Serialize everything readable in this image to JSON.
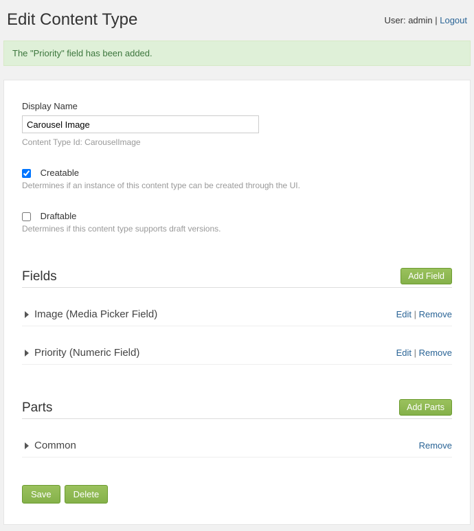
{
  "header": {
    "title": "Edit Content Type",
    "user_prefix": "User: ",
    "user_name": "admin",
    "sep": " | ",
    "logout": "Logout"
  },
  "notice": "The \"Priority\" field has been added.",
  "display_name": {
    "label": "Display Name",
    "value": "Carousel Image",
    "hint": "Content Type Id: CarouselImage"
  },
  "creatable": {
    "label": "Creatable",
    "hint": "Determines if an instance of this content type can be created through the UI.",
    "checked": true
  },
  "draftable": {
    "label": "Draftable",
    "hint": "Determines if this content type supports draft versions.",
    "checked": false
  },
  "fields": {
    "title": "Fields",
    "add_label": "Add Field",
    "items": [
      {
        "label": "Image (Media Picker Field)",
        "edit": "Edit",
        "remove": "Remove"
      },
      {
        "label": "Priority (Numeric Field)",
        "edit": "Edit",
        "remove": "Remove"
      }
    ]
  },
  "parts": {
    "title": "Parts",
    "add_label": "Add Parts",
    "items": [
      {
        "label": "Common",
        "remove": "Remove"
      }
    ]
  },
  "actions": {
    "save": "Save",
    "delete": "Delete"
  },
  "sep_pipe": " | "
}
